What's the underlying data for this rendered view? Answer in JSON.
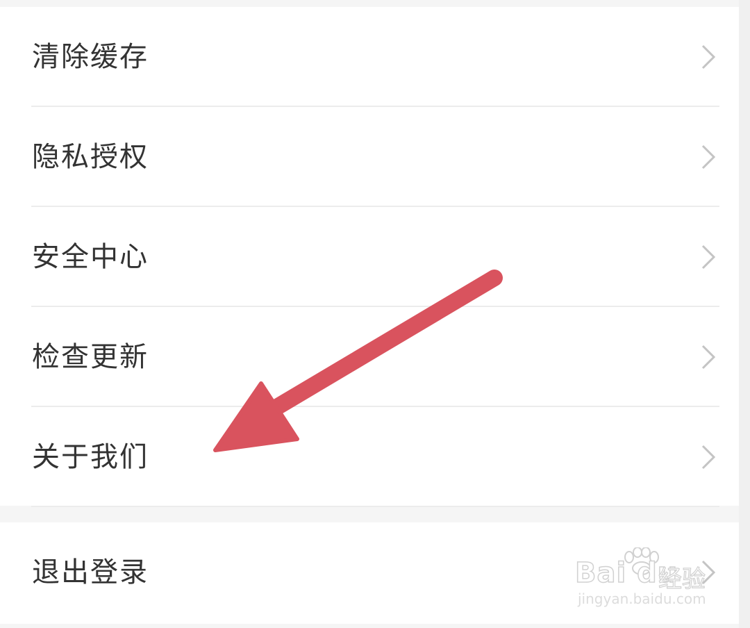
{
  "settings_group": {
    "items": [
      {
        "label": "清除缓存"
      },
      {
        "label": "隐私授权"
      },
      {
        "label": "安全中心"
      },
      {
        "label": "检查更新"
      },
      {
        "label": "关于我们"
      }
    ]
  },
  "logout_group": {
    "label": "退出登录"
  },
  "annotation": {
    "arrow_color": "#d9535e"
  },
  "watermark": {
    "logo_text": "Bai du",
    "product_text": "经验",
    "url": "jingyan.baidu.com"
  },
  "icons": {
    "row_chevron": "chevron-right-icon"
  }
}
